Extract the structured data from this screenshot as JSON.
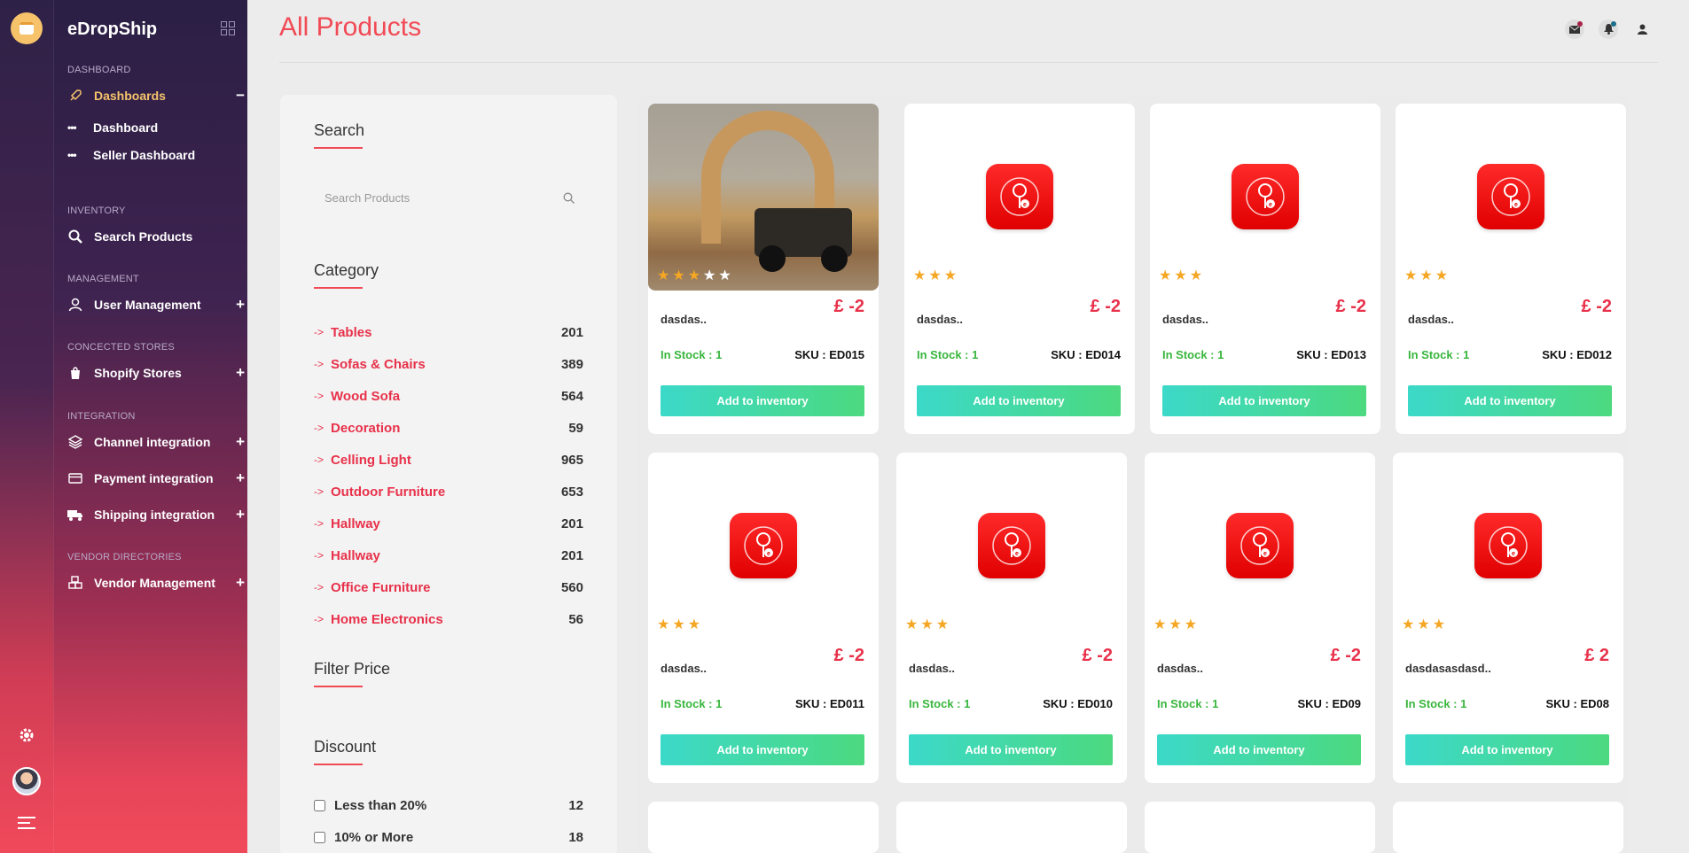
{
  "app": {
    "brand": "eDropShip"
  },
  "sidebar": {
    "sections": {
      "dashboard": "DASHBOARD",
      "inventory": "INVENTORY",
      "management": "MANAGEMENT",
      "stores": "CONCECTED STORES",
      "integration": "INTEGRATION",
      "vendor": "VENDOR DIRECTORIES"
    },
    "dashboards": "Dashboards",
    "dashboard": "Dashboard",
    "seller_dashboard": "Seller Dashboard",
    "search_products": "Search Products",
    "user_management": "User Management",
    "shopify_stores": "Shopify Stores",
    "channel_integration": "Channel integration",
    "payment_integration": "Payment integration",
    "shipping_integration": "Shipping integration",
    "vendor_management": "Vendor Management",
    "collapse_symbol": "−",
    "expand_symbol": "+"
  },
  "header": {
    "title": "All Products"
  },
  "filter": {
    "search_heading": "Search",
    "search_placeholder": "Search Products",
    "category_heading": "Category",
    "categories": [
      {
        "name": "Tables",
        "count": "201"
      },
      {
        "name": "Sofas & Chairs",
        "count": "389"
      },
      {
        "name": "Wood Sofa",
        "count": "564"
      },
      {
        "name": "Decoration",
        "count": "59"
      },
      {
        "name": "Celling Light",
        "count": "965"
      },
      {
        "name": "Outdoor Furniture",
        "count": "653"
      },
      {
        "name": "Hallway",
        "count": "201"
      },
      {
        "name": "Hallway",
        "count": "201"
      },
      {
        "name": "Office Furniture",
        "count": "560"
      },
      {
        "name": "Home Electronics",
        "count": "56"
      }
    ],
    "price_heading": "Filter Price",
    "discount_heading": "Discount",
    "discounts": [
      {
        "label": "Less than 20%",
        "count": "12"
      },
      {
        "label": "10% or More",
        "count": "18"
      }
    ]
  },
  "products": [
    {
      "name": "dasdas..",
      "price": "£ -2",
      "stock": "In Stock : 1",
      "sku": "SKU : ED015",
      "rating": 3,
      "image": "photo-jeep",
      "button": "Add to inventory"
    },
    {
      "name": "dasdas..",
      "price": "£ -2",
      "stock": "In Stock : 1",
      "sku": "SKU : ED014",
      "rating": 3,
      "image": "app-icon",
      "button": "Add to inventory"
    },
    {
      "name": "dasdas..",
      "price": "£ -2",
      "stock": "In Stock : 1",
      "sku": "SKU : ED013",
      "rating": 3,
      "image": "app-icon",
      "button": "Add to inventory"
    },
    {
      "name": "dasdas..",
      "price": "£ -2",
      "stock": "In Stock : 1",
      "sku": "SKU : ED012",
      "rating": 3,
      "image": "app-icon",
      "button": "Add to inventory"
    },
    {
      "name": "dasdas..",
      "price": "£ -2",
      "stock": "In Stock : 1",
      "sku": "SKU : ED011",
      "rating": 3,
      "image": "app-icon",
      "button": "Add to inventory"
    },
    {
      "name": "dasdas..",
      "price": "£ -2",
      "stock": "In Stock : 1",
      "sku": "SKU : ED010",
      "rating": 3,
      "image": "app-icon",
      "button": "Add to inventory"
    },
    {
      "name": "dasdas..",
      "price": "£ -2",
      "stock": "In Stock : 1",
      "sku": "SKU : ED09",
      "rating": 3,
      "image": "app-icon",
      "button": "Add to inventory"
    },
    {
      "name": "dasdasasdasd..",
      "price": "£ 2",
      "stock": "In Stock : 1",
      "sku": "SKU : ED08",
      "rating": 3,
      "image": "app-icon",
      "button": "Add to inventory"
    }
  ],
  "colors": {
    "accent": "#f14a55",
    "stock": "#38b63c",
    "star": "#f5a623",
    "button_from": "#3cd9c9",
    "button_to": "#4cd97f"
  }
}
